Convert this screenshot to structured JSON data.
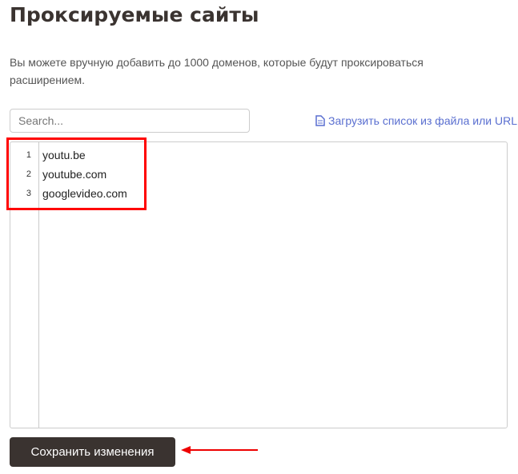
{
  "title": "Проксируемые сайты",
  "description": "Вы можете вручную добавить до 1000 доменов, которые будут проксироваться расширением.",
  "search": {
    "placeholder": "Search..."
  },
  "upload_label": "Загрузить список из файла или URL",
  "lines": [
    {
      "n": "1",
      "text": "youtu.be"
    },
    {
      "n": "2",
      "text": "youtube.com"
    },
    {
      "n": "3",
      "text": "googlevideo.com"
    }
  ],
  "save_label": "Сохранить изменения"
}
